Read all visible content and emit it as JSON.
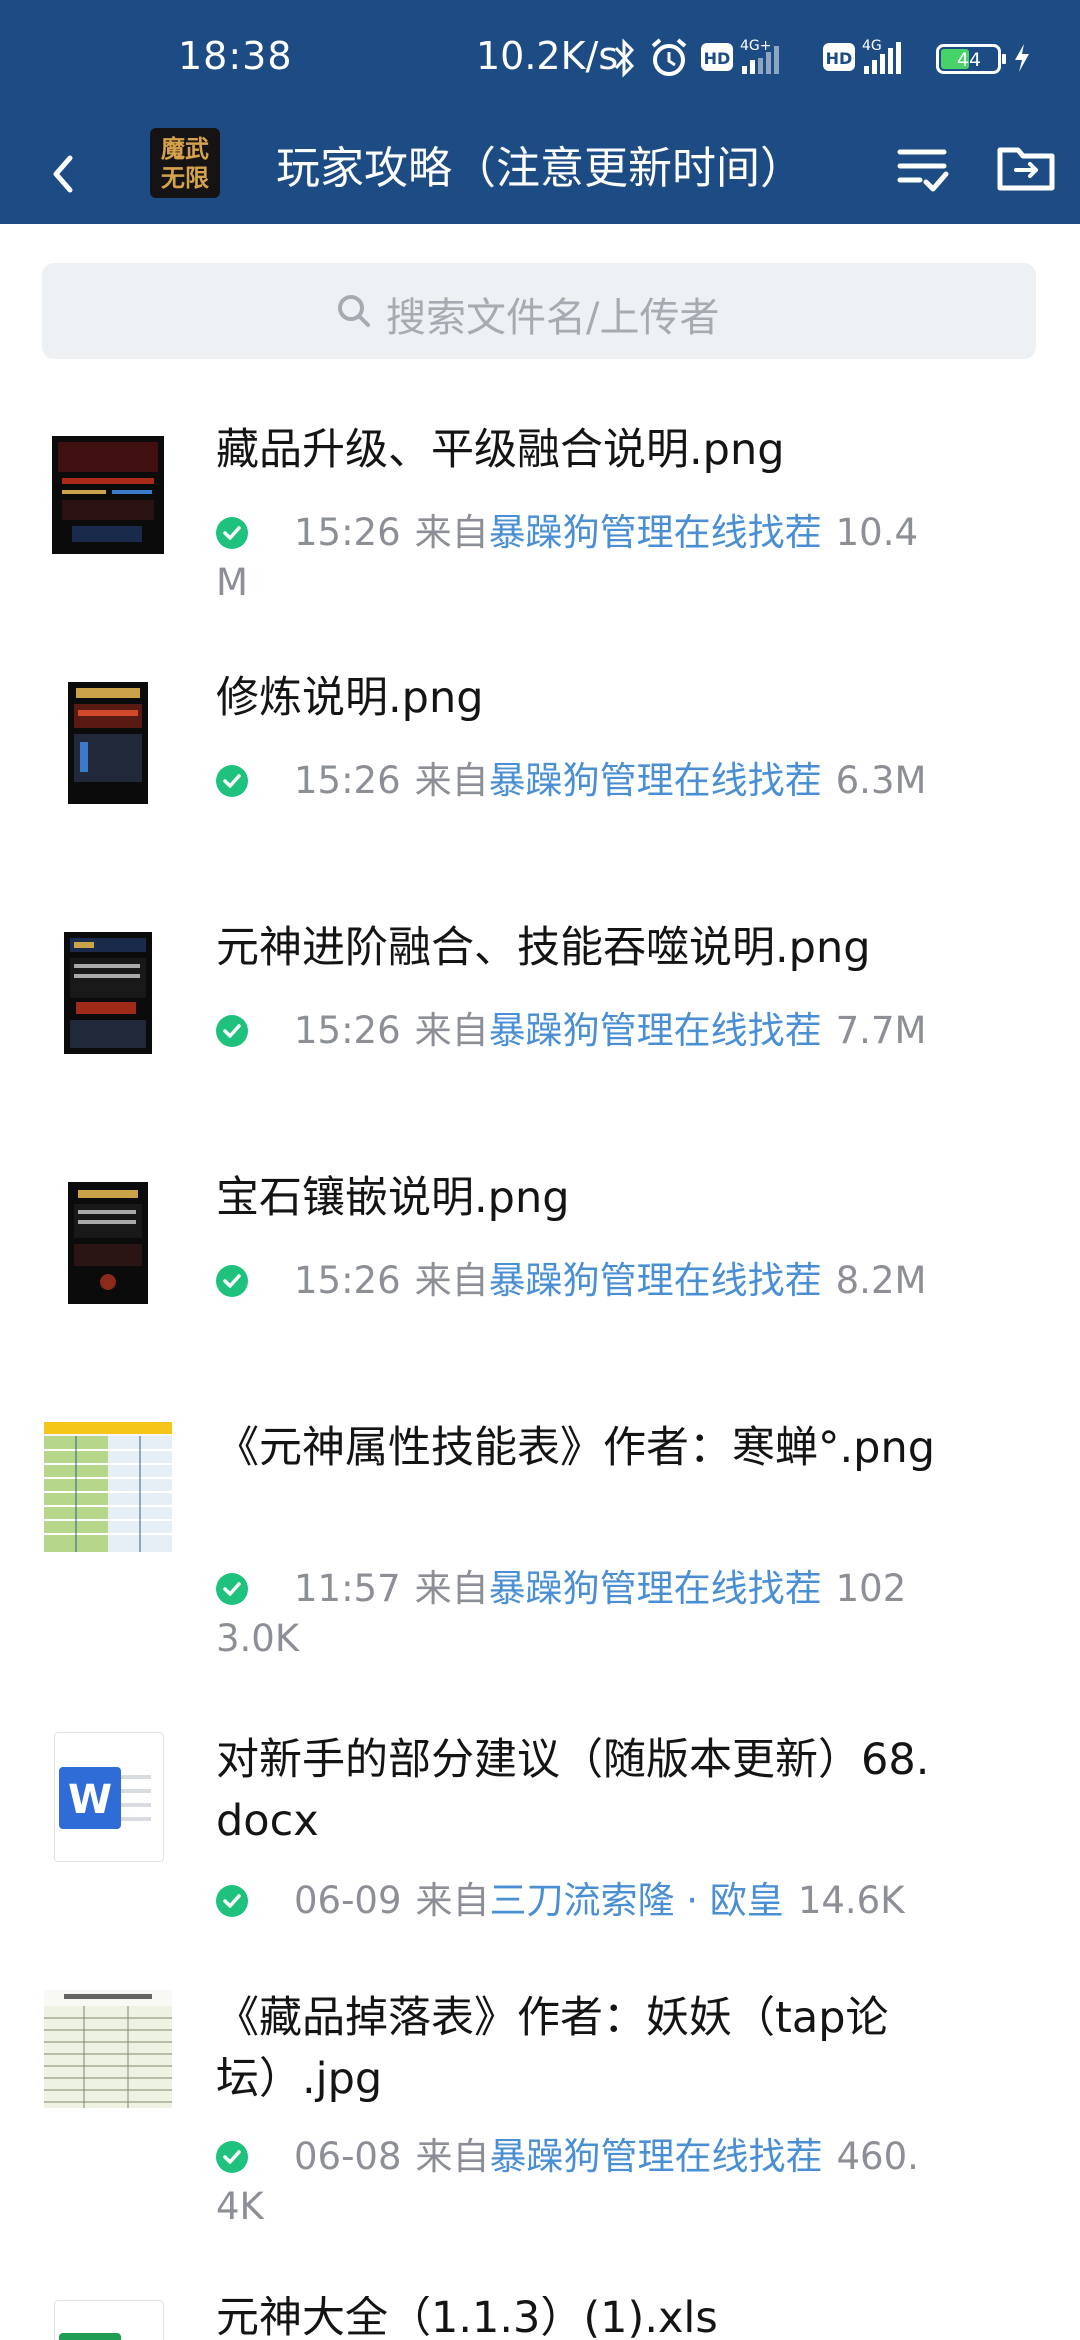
{
  "status_bar": {
    "time": "18:38",
    "net_speed": "10.2K/s",
    "battery": "44",
    "icons": [
      "bluetooth-icon",
      "alarm-icon",
      "hd-icon",
      "signal-4g-plus-icon",
      "hd-icon",
      "signal-4g-icon",
      "battery-icon",
      "charging-icon"
    ]
  },
  "header": {
    "avatar_text": "魔武\n无限",
    "title": "玩家攻略（注意更新时间）"
  },
  "search": {
    "placeholder": "搜索文件名/上传者"
  },
  "files": [
    {
      "name": "藏品升级、平级融合说明.png",
      "time": "15:26",
      "from": "来自",
      "uploader": "暴躁狗管理在线找茬",
      "size": "10.4M",
      "thumb": "dark-game-screenshot"
    },
    {
      "name": "修炼说明.png",
      "time": "15:26",
      "from": "来自",
      "uploader": "暴躁狗管理在线找茬",
      "size": "6.3M",
      "thumb": "dark-game-screenshot"
    },
    {
      "name": "元神进阶融合、技能吞噬说明.png",
      "time": "15:26",
      "from": "来自",
      "uploader": "暴躁狗管理在线找茬",
      "size": "7.7M",
      "thumb": "dark-game-screenshot"
    },
    {
      "name": "宝石镶嵌说明.png",
      "time": "15:26",
      "from": "来自",
      "uploader": "暴躁狗管理在线找茬",
      "size": "8.2M",
      "thumb": "dark-game-screenshot"
    },
    {
      "name": "《元神属性技能表》作者：寒蝉°.png",
      "time": "11:57",
      "from": "来自",
      "uploader": "暴躁狗管理在线找茬",
      "size": "1023.0K",
      "thumb": "spreadsheet-image"
    },
    {
      "name": "对新手的部分建议（随版本更新）68.docx",
      "time": "06-09",
      "from": "来自",
      "uploader": "三刀流索隆 · 欧皇",
      "size": "14.6K",
      "thumb": "word-icon"
    },
    {
      "name": "《藏品掉落表》作者：妖妖（tap论坛）.jpg",
      "time": "06-08",
      "from": "来自",
      "uploader": "暴躁狗管理在线找茬",
      "size": "460.4K",
      "thumb": "table-image"
    },
    {
      "name": "元神大全（1.1.3）(1).xls",
      "thumb": "excel-icon"
    }
  ]
}
